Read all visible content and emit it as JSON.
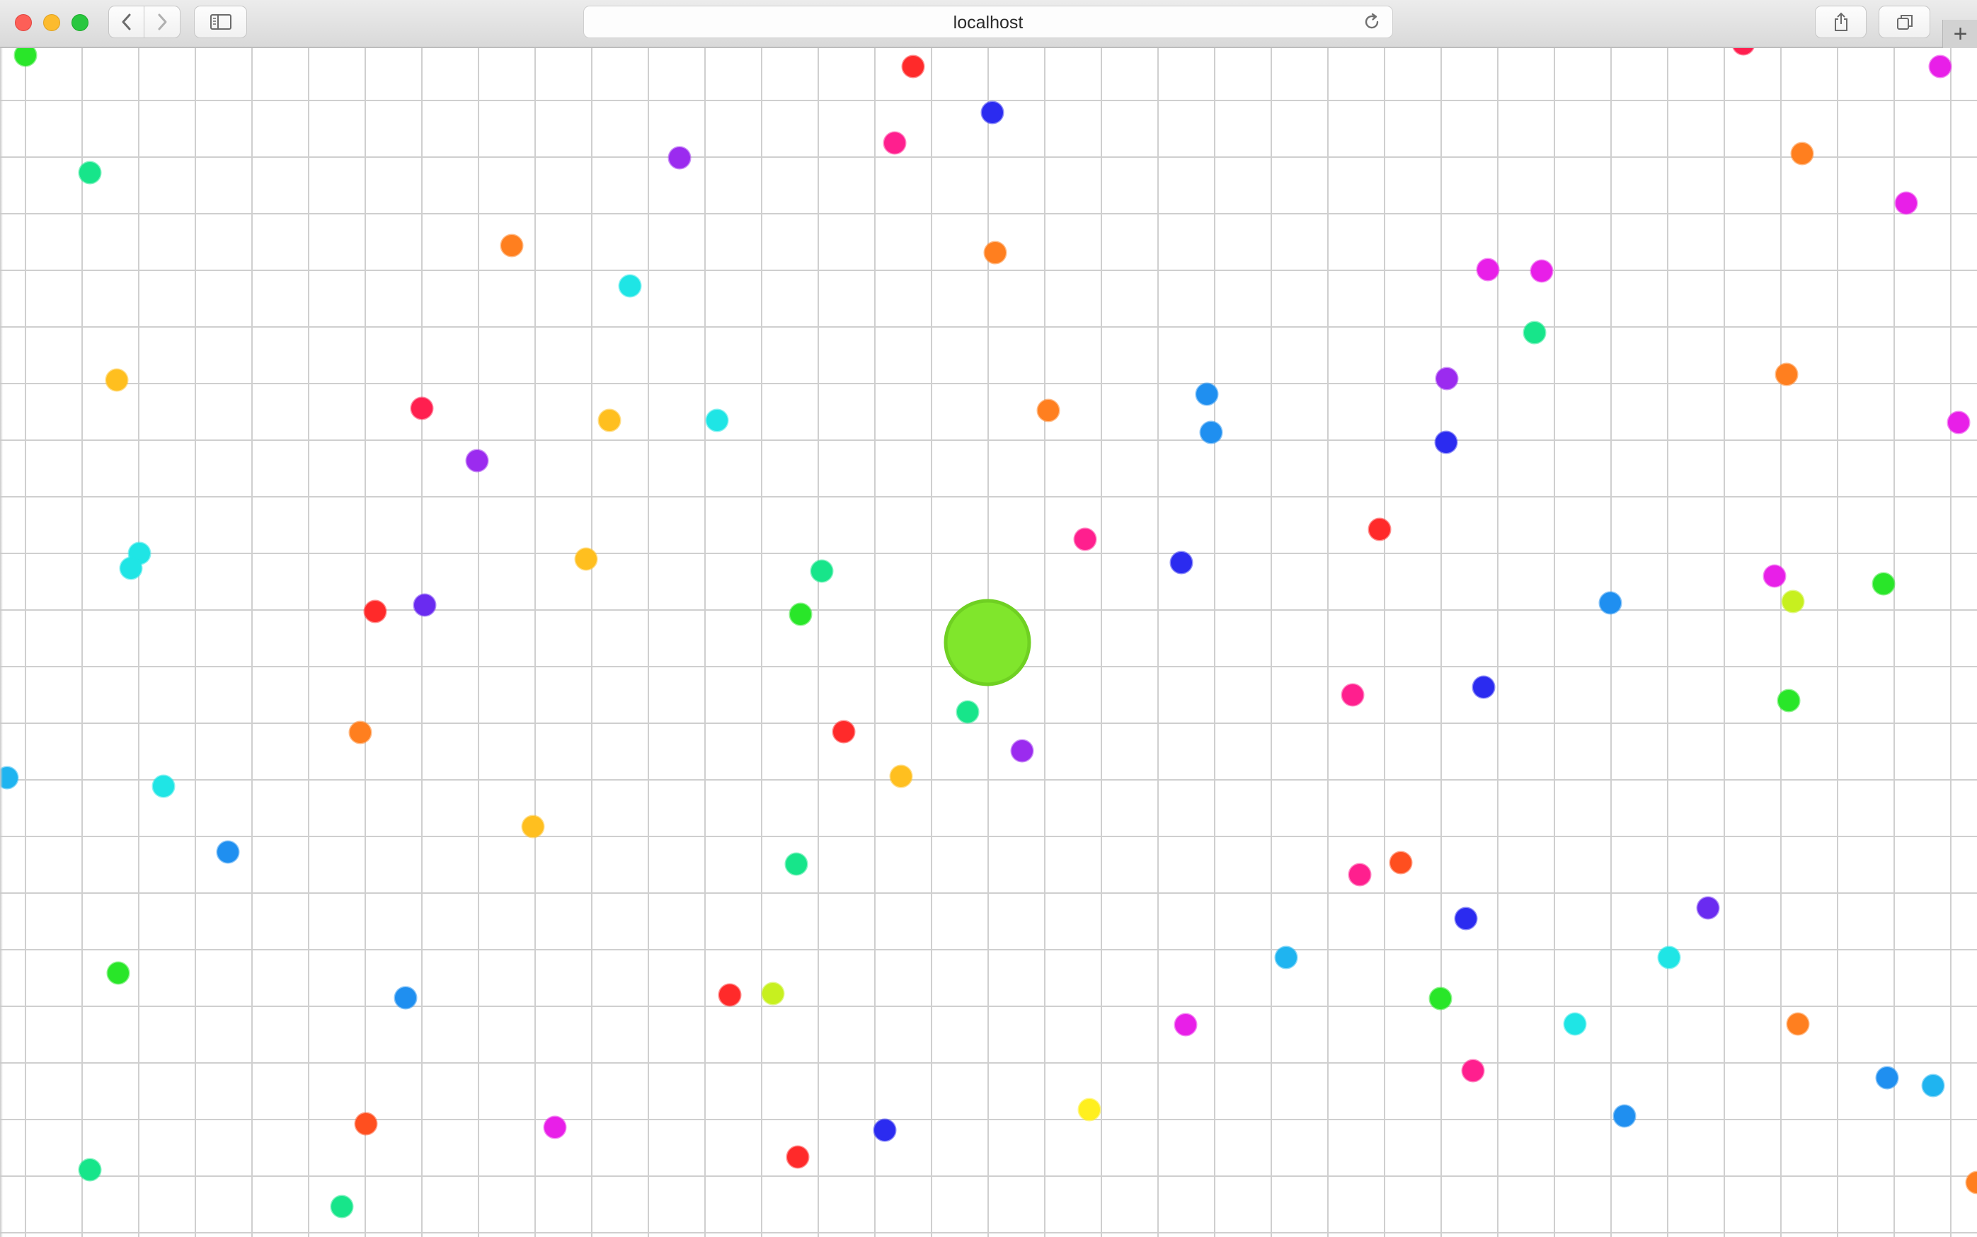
{
  "window": {
    "address_text": "localhost"
  },
  "icons": {
    "close": "close-traffic-light",
    "minimize": "minimize-traffic-light",
    "zoom": "zoom-traffic-light",
    "back": "chevron-left-icon",
    "forward": "chevron-right-icon",
    "sidebar": "sidebar-icon",
    "reload": "reload-icon",
    "share": "share-icon",
    "tabs": "tabs-icon",
    "new_tab": "plus-icon"
  },
  "game": {
    "background": "#ffffff",
    "grid_color": "#cfcfcf",
    "player": {
      "color": "#80e62c",
      "border": "#6fd022"
    },
    "food_palette": [
      "#ff2a2a",
      "#2b2bf0",
      "#ff1f8e",
      "#9b2bef",
      "#ff7f1f",
      "#1fe5e5",
      "#ffbf1f",
      "#17e58a",
      "#29e629",
      "#1f8ff0",
      "#ff1f4f",
      "#e81fe8",
      "#c7f01f",
      "#6a2bf0",
      "#1fb4f0",
      "#ff4f1f",
      "#ffef1f"
    ]
  }
}
